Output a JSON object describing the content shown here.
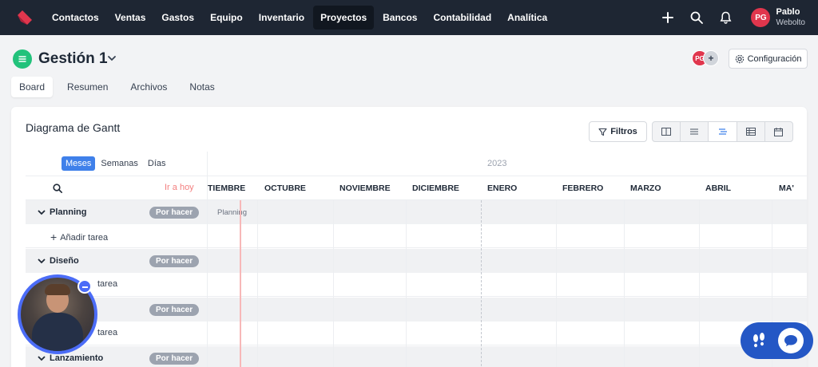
{
  "nav": {
    "items": [
      "Contactos",
      "Ventas",
      "Gastos",
      "Equipo",
      "Inventario",
      "Proyectos",
      "Bancos",
      "Contabilidad",
      "Analítica"
    ],
    "active": "Proyectos",
    "user": {
      "initials": "PG",
      "name": "Pablo",
      "company": "Webolto"
    },
    "icons": [
      "plus-icon",
      "search-icon",
      "bell-icon"
    ]
  },
  "header": {
    "title": "Gestión 1",
    "avatar_initials": "PG",
    "add_member": "+",
    "config_label": "Configuración"
  },
  "tabs": [
    "Board",
    "Resumen",
    "Archivos",
    "Notas"
  ],
  "gantt": {
    "title": "Diagrama de Gantt",
    "filter_label": "Filtros",
    "view_icons": [
      "columns-icon",
      "list-icon",
      "gantt-icon",
      "table-icon",
      "calendar-icon"
    ],
    "active_view": "gantt-icon",
    "scales": [
      "Meses",
      "Semanas",
      "Días"
    ],
    "active_scale": "Meses",
    "year": "2023",
    "today_label": "Ir a hoy",
    "months": [
      "TIEMBRE",
      "OCTUBRE",
      "NOVIEMBRE",
      "DICIEMBRE",
      "ENERO",
      "FEBRERO",
      "MARZO",
      "ABRIL",
      "MA'"
    ],
    "add_task_label": "Añadir tarea",
    "bar_label": "Planning",
    "groups": [
      {
        "name": "Planning",
        "status": "Por hacer"
      },
      {
        "name": "Diseño",
        "status": "Por hacer"
      },
      {
        "name": "",
        "status": "Por hacer"
      },
      {
        "name": "Lanzamiento",
        "status": "Por hacer"
      }
    ],
    "partial_add_task": "tarea"
  },
  "colors": {
    "nav_bg": "#1e2633",
    "accent": "#3f80ea",
    "today_line": "#f7b8b8",
    "badge": "#9ca3af",
    "project_icon": "#22c27b",
    "help_widget": "#2457c5"
  }
}
